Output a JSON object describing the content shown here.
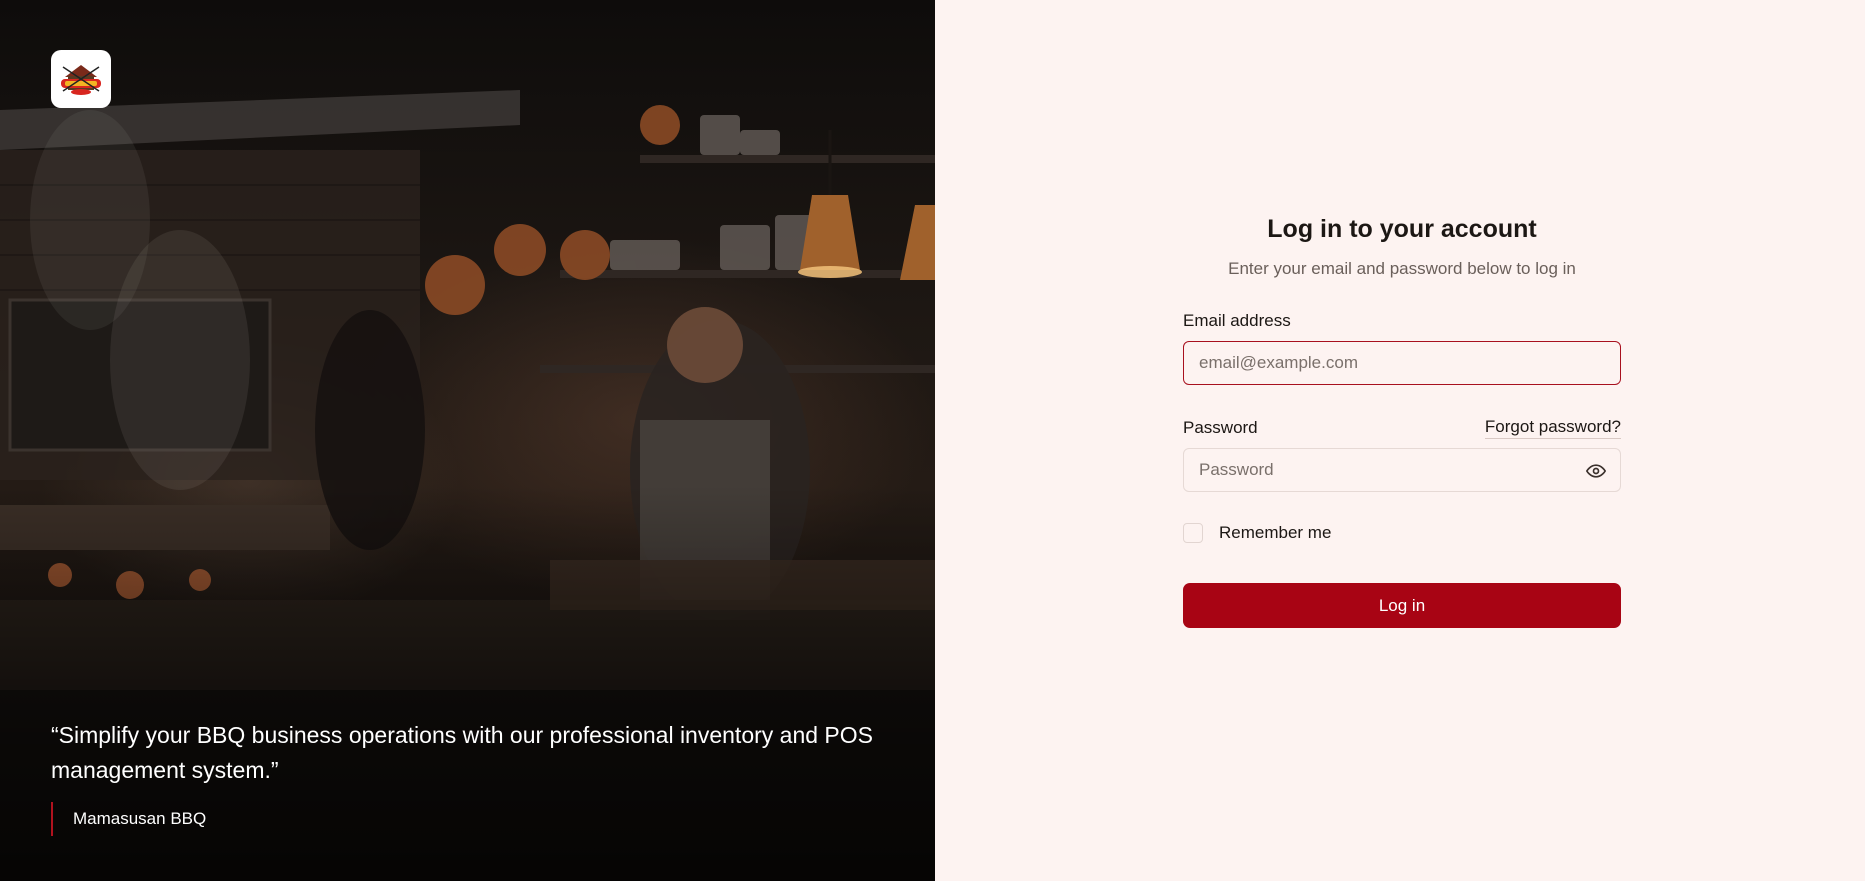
{
  "brand": {
    "logo_icon": "mamasusan-bbq-logo-icon",
    "accent_color": "#a80414"
  },
  "hero": {
    "quote": "“Simplify your BBQ business operations with our professional inventory and POS management system.”",
    "attribution": "Mamasusan BBQ"
  },
  "login": {
    "title": "Log in to your account",
    "subtitle": "Enter your email and password below to log in",
    "email": {
      "label": "Email address",
      "placeholder": "email@example.com",
      "value": ""
    },
    "password": {
      "label": "Password",
      "placeholder": "Password",
      "value": "",
      "forgot_link": "Forgot password?",
      "toggle_icon": "eye-icon"
    },
    "remember_me": {
      "label": "Remember me",
      "checked": false
    },
    "submit_label": "Log in"
  }
}
